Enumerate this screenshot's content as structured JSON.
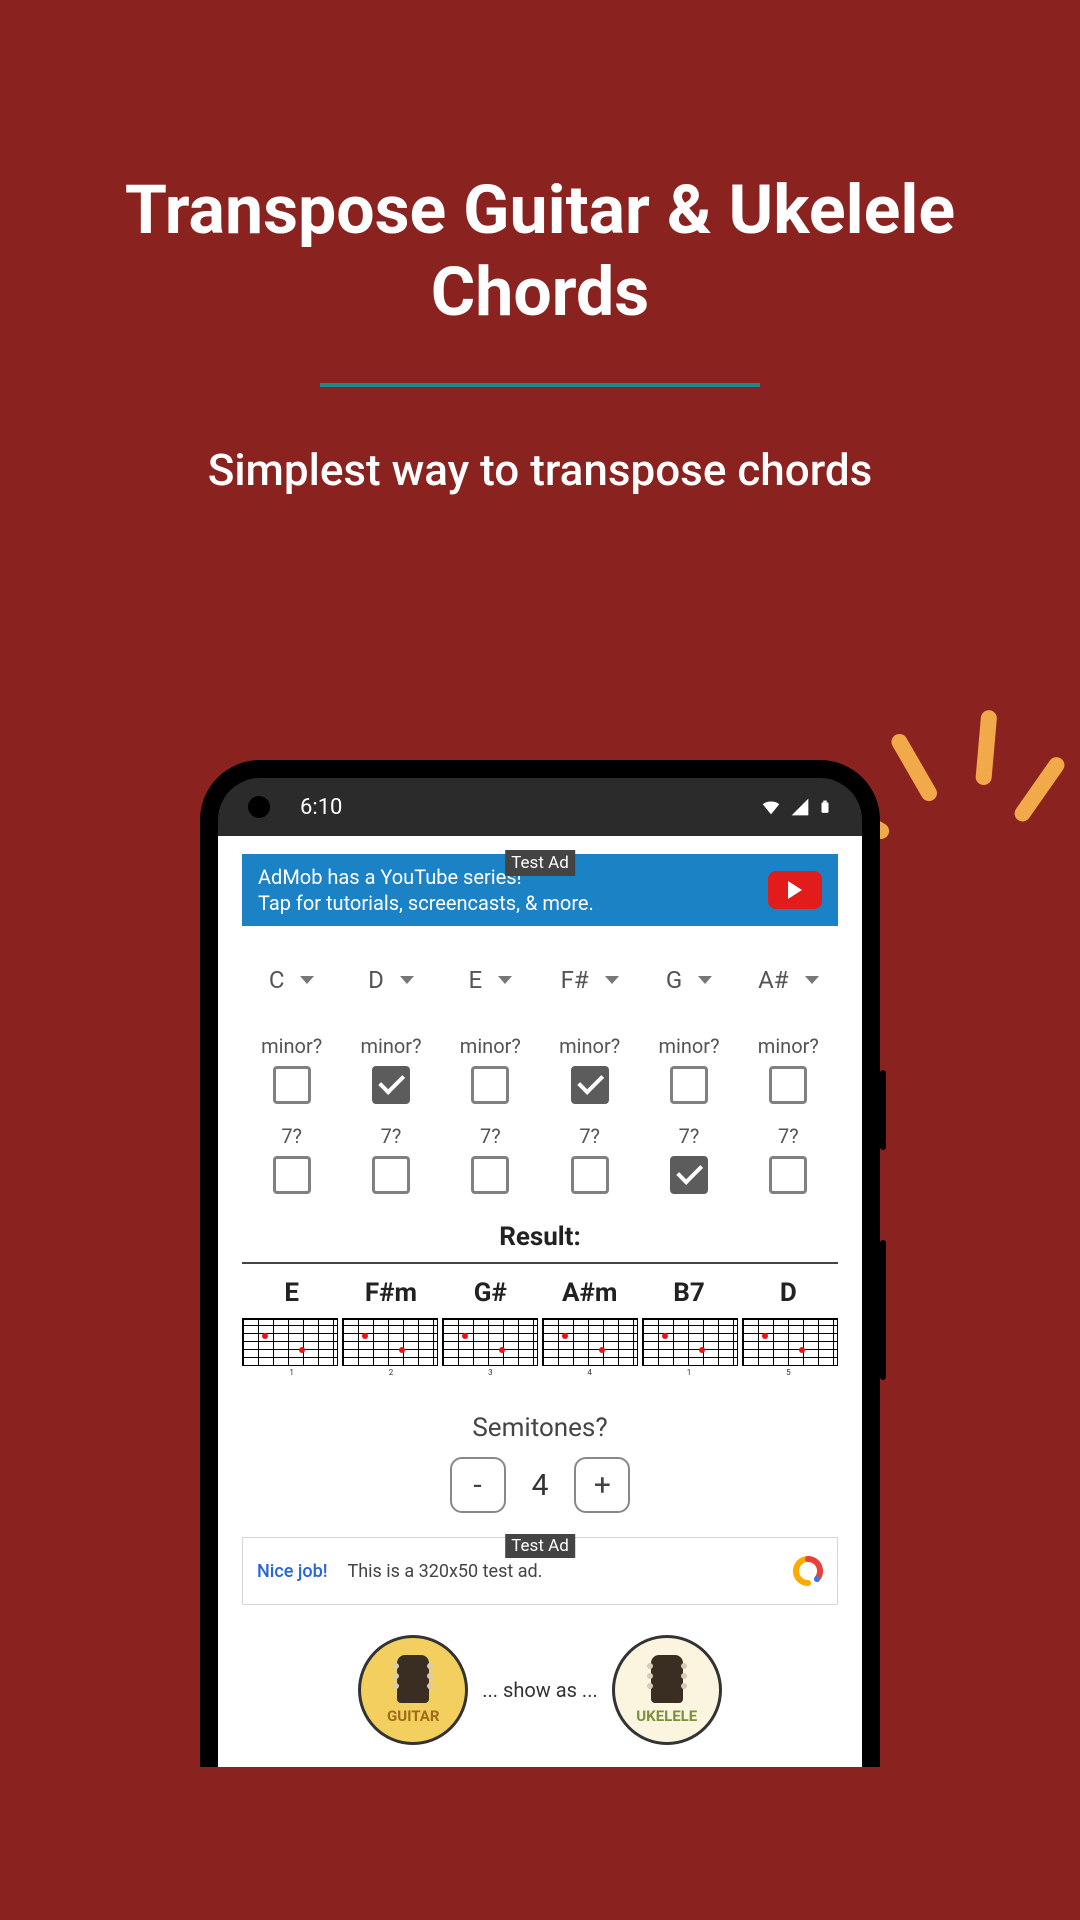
{
  "hero": {
    "title": "Transpose Guitar & Ukelele Chords",
    "subtitle": "Simplest way to transpose chords"
  },
  "status_bar": {
    "time": "6:10"
  },
  "ad1": {
    "label": "Test Ad",
    "line1": "AdMob has a YouTube series!",
    "line2": "Tap for tutorials, screencasts, & more."
  },
  "chord_selectors": [
    "C",
    "D",
    "E",
    "F#",
    "G",
    "A#"
  ],
  "minor": {
    "label": "minor?",
    "states": [
      false,
      true,
      false,
      true,
      false,
      false
    ]
  },
  "seventh": {
    "label": "7?",
    "states": [
      false,
      false,
      false,
      false,
      true,
      false
    ]
  },
  "result": {
    "header": "Result:",
    "chords": [
      "E",
      "F#m",
      "G#",
      "A#m",
      "B7",
      "D"
    ]
  },
  "semitones": {
    "label": "Semitones?",
    "minus": "-",
    "value": "4",
    "plus": "+"
  },
  "ad2": {
    "label": "Test Ad",
    "nice": "Nice job!",
    "body": "This is a 320x50 test ad."
  },
  "instruments": {
    "guitar": "GUITAR",
    "show_as": "... show as ...",
    "ukelele": "UKELELE"
  }
}
